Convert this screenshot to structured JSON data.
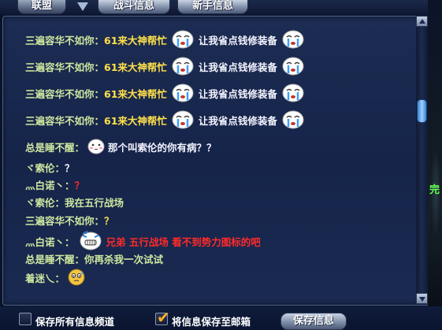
{
  "tabs": [
    {
      "label": "联盟"
    },
    {
      "label": "战斗信息"
    },
    {
      "label": "新手信息"
    }
  ],
  "messages": [
    {
      "parts": [
        {
          "text": "三遍容华不如你："
        },
        {
          "text": "61来大神帮忙"
        },
        {
          "emoji": "crying-face"
        },
        {
          "text": "让我省点钱修装备"
        },
        {
          "emoji": "crying-face"
        }
      ]
    },
    {
      "parts": [
        {
          "text": "三遍容华不如你："
        },
        {
          "text": "61来大神帮忙"
        },
        {
          "emoji": "crying-face"
        },
        {
          "text": "让我省点钱修装备"
        },
        {
          "emoji": "crying-face"
        }
      ]
    },
    {
      "parts": [
        {
          "text": "三遍容华不如你："
        },
        {
          "text": "61来大神帮忙"
        },
        {
          "emoji": "crying-face"
        },
        {
          "text": "让我省点钱修装备"
        },
        {
          "emoji": "crying-face"
        }
      ]
    },
    {
      "parts": [
        {
          "text": "三遍容华不如你："
        },
        {
          "text": "61来大神帮忙"
        },
        {
          "emoji": "crying-face"
        },
        {
          "text": "让我省点钱修装备"
        },
        {
          "emoji": "crying-face"
        }
      ]
    },
    {
      "parts": [
        {
          "text": "总是睡不醒："
        },
        {
          "emoji": "blushing-face"
        },
        {
          "text": "那个叫索伦的你有病？？"
        }
      ]
    },
    {
      "parts": [
        {
          "text": "ヾ索伦："
        },
        {
          "text": "？"
        }
      ]
    },
    {
      "parts": [
        {
          "text": "灬白诺丶："
        },
        {
          "text": "？"
        }
      ]
    },
    {
      "parts": [
        {
          "text": "ヾ索伦：我在五行战场"
        }
      ]
    },
    {
      "parts": [
        {
          "text": "三遍容华不如你："
        },
        {
          "text": "？"
        }
      ]
    },
    {
      "parts": [
        {
          "text": "灬白诺丶："
        },
        {
          "emoji": "grimace-face"
        },
        {
          "text": "兄弟 五行战场 看不到势力图标的吧"
        }
      ]
    },
    {
      "parts": [
        {
          "text": "总是睡不醒：你再杀我一次试试"
        }
      ]
    },
    {
      "parts": [
        {
          "text": "着迷乀："
        },
        {
          "emoji": "sweat-face"
        }
      ]
    }
  ],
  "right_edge_text": "完",
  "bottom": {
    "save_all_label": "保存所有信息频道",
    "save_all_checked": false,
    "save_mail_label": "将信息保存至邮箱",
    "save_mail_checked": true,
    "save_button_label": "保存信息"
  },
  "colors": {
    "name_green": "#cfe8a0",
    "highlight_yellow": "#ffe14a",
    "alert_red": "#ff2a2a",
    "thumb_blue": "#5aa8f0"
  }
}
